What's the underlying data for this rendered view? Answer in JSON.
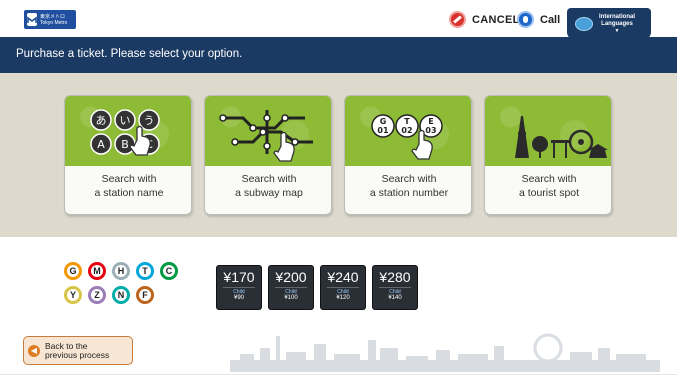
{
  "top": {
    "logo_text": "東京メトロ Tokyo Metro",
    "cancel_label": "CANCEL",
    "call_label": "Call",
    "language_label_1": "International",
    "language_label_2": "Languages"
  },
  "header": {
    "title": "Purchase a ticket. Please select your option."
  },
  "options": [
    {
      "line1": "Search with",
      "line2": "a station name",
      "icon": "station-name-icon"
    },
    {
      "line1": "Search with",
      "line2": "a subway map",
      "icon": "subway-map-icon"
    },
    {
      "line1": "Search with",
      "line2": "a station number",
      "icon": "station-number-icon"
    },
    {
      "line1": "Search with",
      "line2": "a tourist spot",
      "icon": "tourist-spot-icon"
    }
  ],
  "line_marks": [
    {
      "letter": "G",
      "color": "#f39700"
    },
    {
      "letter": "M",
      "color": "#e60012"
    },
    {
      "letter": "H",
      "color": "#9caeb7"
    },
    {
      "letter": "T",
      "color": "#00a7db"
    },
    {
      "letter": "C",
      "color": "#009944"
    },
    {
      "letter": "Y",
      "color": "#d7c447"
    },
    {
      "letter": "Z",
      "color": "#9b7cb6"
    },
    {
      "letter": "N",
      "color": "#00ada9"
    },
    {
      "letter": "F",
      "color": "#bb641d"
    }
  ],
  "fares": [
    {
      "adult": "¥170",
      "child_label": "Child",
      "child": "¥90"
    },
    {
      "adult": "¥200",
      "child_label": "Child",
      "child": "¥100"
    },
    {
      "adult": "¥240",
      "child_label": "Child",
      "child": "¥120"
    },
    {
      "adult": "¥280",
      "child_label": "Child",
      "child": "¥140"
    }
  ],
  "back": {
    "line1": "Back to the",
    "line2": "previous process"
  },
  "colors": {
    "navy": "#1b3a63",
    "green": "#8dbb35",
    "panel": "#ddd9cc"
  }
}
